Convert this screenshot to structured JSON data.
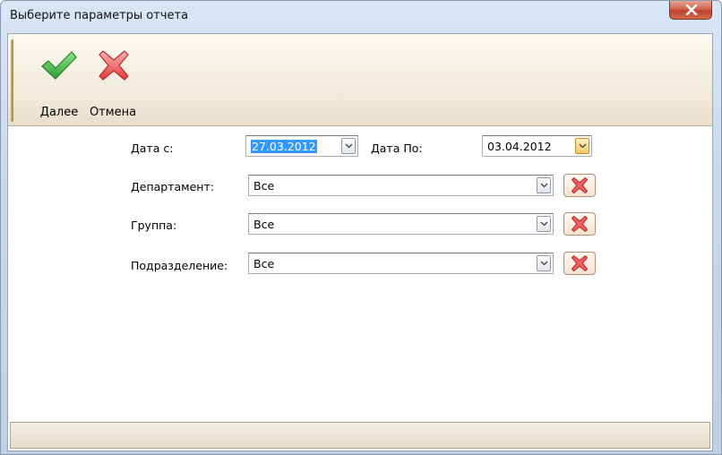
{
  "window": {
    "title": "Выберите параметры отчета"
  },
  "toolbar": {
    "next_label": "Далее",
    "cancel_label": "Отмена"
  },
  "form": {
    "date_from_label": "Дата с:",
    "date_from_value": "27.03.2012",
    "date_to_label": "Дата По:",
    "date_to_value": "03.04.2012",
    "department_label": "Департамент:",
    "department_value": "Все",
    "group_label": "Группа:",
    "group_value": "Все",
    "subdivision_label": "Подразделение:",
    "subdivision_value": "Все"
  },
  "colors": {
    "selection": "#3399ff",
    "accept_green": "#3cb83c",
    "cancel_red": "#e03030"
  }
}
